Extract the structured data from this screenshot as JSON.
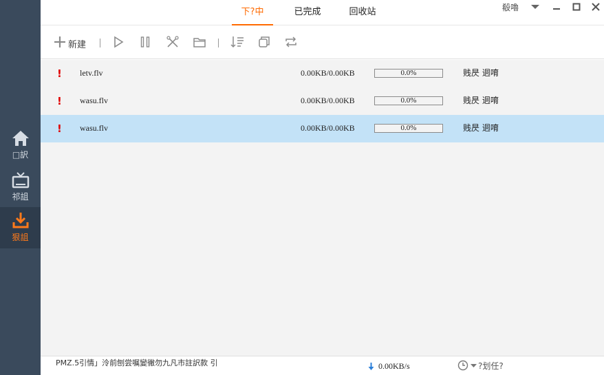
{
  "sidebar": {
    "items": [
      {
        "label": "□訳",
        "icon": "home-icon"
      },
      {
        "label": "祁詛",
        "icon": "tv-icon"
      },
      {
        "label": "狠詛",
        "icon": "download-icon",
        "active": true
      }
    ]
  },
  "tabs": [
    {
      "label": "下?中",
      "active": true
    },
    {
      "label": "已完成"
    },
    {
      "label": "回收站"
    }
  ],
  "window": {
    "user_label": "殽嚕",
    "icons": [
      "dropdown-icon",
      "minimize-icon",
      "maximize-icon",
      "close-icon"
    ]
  },
  "toolbar": {
    "new_label": "新建",
    "icons": [
      "plus-icon",
      "play-icon",
      "pause-icon",
      "delete-icon",
      "folder-icon",
      "sort-icon",
      "copy-icon",
      "repeat-icon"
    ]
  },
  "downloads": [
    {
      "name": "letv.flv",
      "size": "0.00KB/0.00KB",
      "progress": 0.0,
      "progress_label": "0.0%",
      "status": "贱昃 迵唷",
      "selected": false
    },
    {
      "name": "wasu.flv",
      "size": "0.00KB/0.00KB",
      "progress": 0.0,
      "progress_label": "0.0%",
      "status": "贱昃 迵唷",
      "selected": false
    },
    {
      "name": "wasu.flv",
      "size": "0.00KB/0.00KB",
      "progress": 0.0,
      "progress_label": "0.0%",
      "status": "贱昃 迵唷",
      "selected": true
    }
  ],
  "statusbar": {
    "tip": "PMZ.5引情」泠前刨尝嘱變徶勿九凡市註訳款 引",
    "speed": "0.00KB/s",
    "plan_label": "?划任?"
  },
  "colors": {
    "sidebar_bg": "#3a4a5c",
    "accent": "#ff6a00",
    "selected_row": "#c3e2f7",
    "error": "#e00000"
  }
}
